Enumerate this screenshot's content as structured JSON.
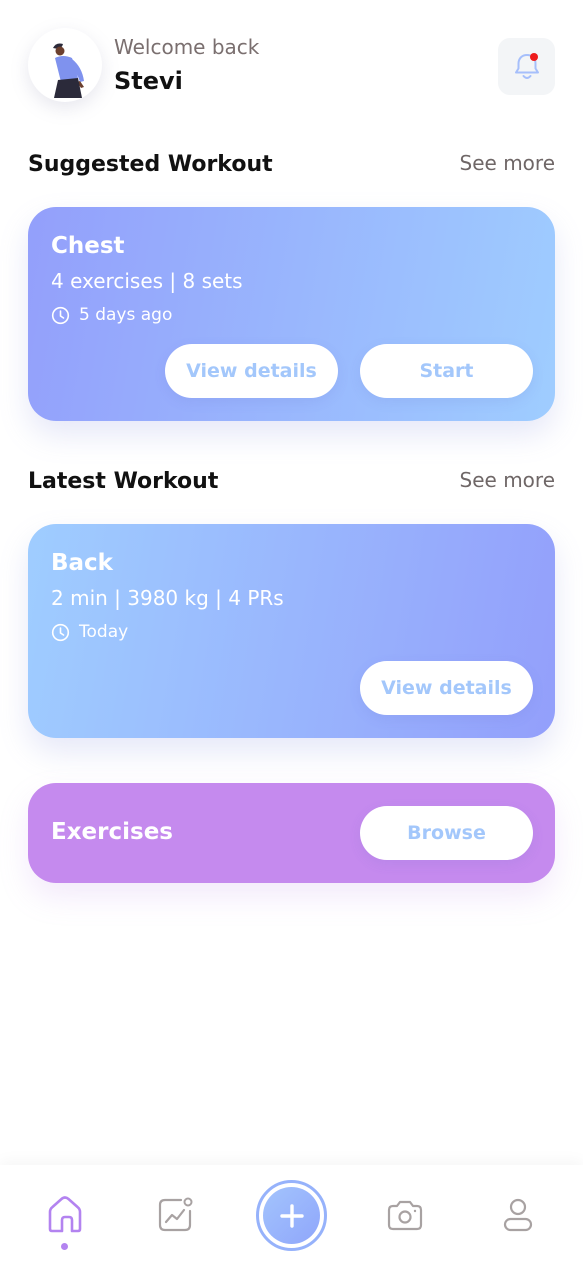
{
  "header": {
    "welcome_text": "Welcome back",
    "username": "Stevi",
    "avatar_icon": "person-running-illustration",
    "notification_icon": "bell-icon",
    "notification_badge_color": "#ee1c1c"
  },
  "suggested": {
    "title": "Suggested Workout",
    "see_more": "See more",
    "card": {
      "name": "Chest",
      "summary": "4 exercises | 8 sets",
      "time_icon": "clock-icon",
      "time": "5 days ago",
      "view_label": "View details",
      "start_label": "Start",
      "gradient": [
        "#939ffb",
        "#9fcdff"
      ]
    }
  },
  "latest": {
    "title": "Latest Workout",
    "see_more": "See more",
    "card": {
      "name": "Back",
      "summary": "2 min | 3980 kg | 4 PRs",
      "time_icon": "clock-icon",
      "time": "Today",
      "view_label": "View details",
      "gradient": [
        "#9fcdff",
        "#939ffb"
      ]
    }
  },
  "exercises": {
    "title": "Exercises",
    "browse_label": "Browse",
    "color": "#c58aee"
  },
  "nav": {
    "items": [
      {
        "icon": "home-icon",
        "active": true
      },
      {
        "icon": "stats-chart-icon",
        "active": false
      },
      {
        "icon": "plus-icon",
        "active": false
      },
      {
        "icon": "camera-icon",
        "active": false
      },
      {
        "icon": "profile-icon",
        "active": false
      }
    ],
    "active_color": "#b383f0",
    "accent_color": "#96b2fb"
  }
}
